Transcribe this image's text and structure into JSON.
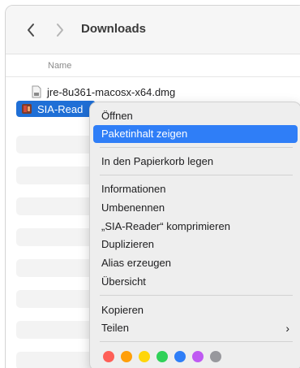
{
  "window": {
    "title": "Downloads",
    "column_name": "Name"
  },
  "files": [
    {
      "name": "jre-8u361-macosx-x64.dmg",
      "icon": "disk-image-icon"
    },
    {
      "name": "SIA-Read",
      "icon": "app-icon",
      "selected": true
    }
  ],
  "menu": {
    "open": "Öffnen",
    "show_package": "Paketinhalt zeigen",
    "trash": "In den Papierkorb legen",
    "info": "Informationen",
    "rename": "Umbenennen",
    "compress": "„SIA-Reader“ komprimieren",
    "duplicate": "Duplizieren",
    "alias": "Alias erzeugen",
    "quicklook": "Übersicht",
    "copy": "Kopieren",
    "share": "Teilen"
  },
  "tag_colors": [
    "#fe5f57",
    "#ff9f0a",
    "#ffd60a",
    "#30d158",
    "#2f7ef7",
    "#bf5af2",
    "#98989d"
  ],
  "colors": {
    "highlight": "#2f7ef7",
    "selection": "#1f6fd6"
  }
}
